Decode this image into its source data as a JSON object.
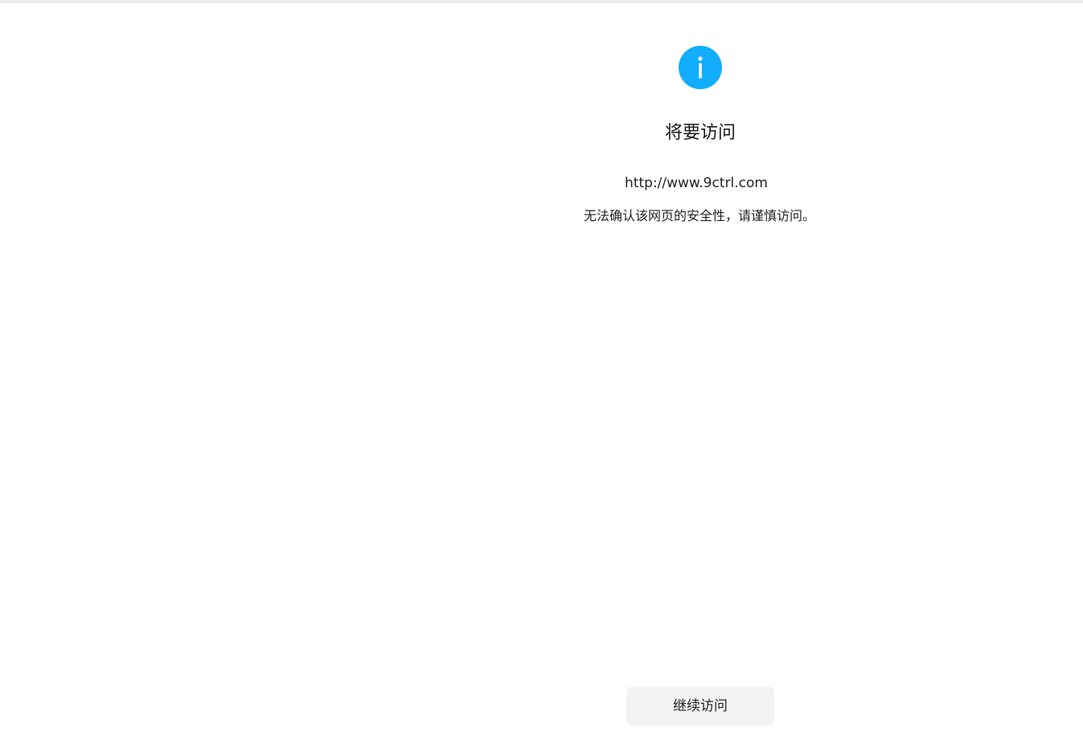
{
  "page": {
    "title": "将要访问",
    "url": "http://www.9ctrl.com",
    "warning": "无法确认该网页的安全性，请谨慎访问。",
    "continue_label": "继续访问"
  },
  "icons": {
    "status": "info-icon"
  },
  "colors": {
    "icon_bg": "#12adff",
    "button_bg": "#f3f3f3",
    "text": "#222222"
  }
}
